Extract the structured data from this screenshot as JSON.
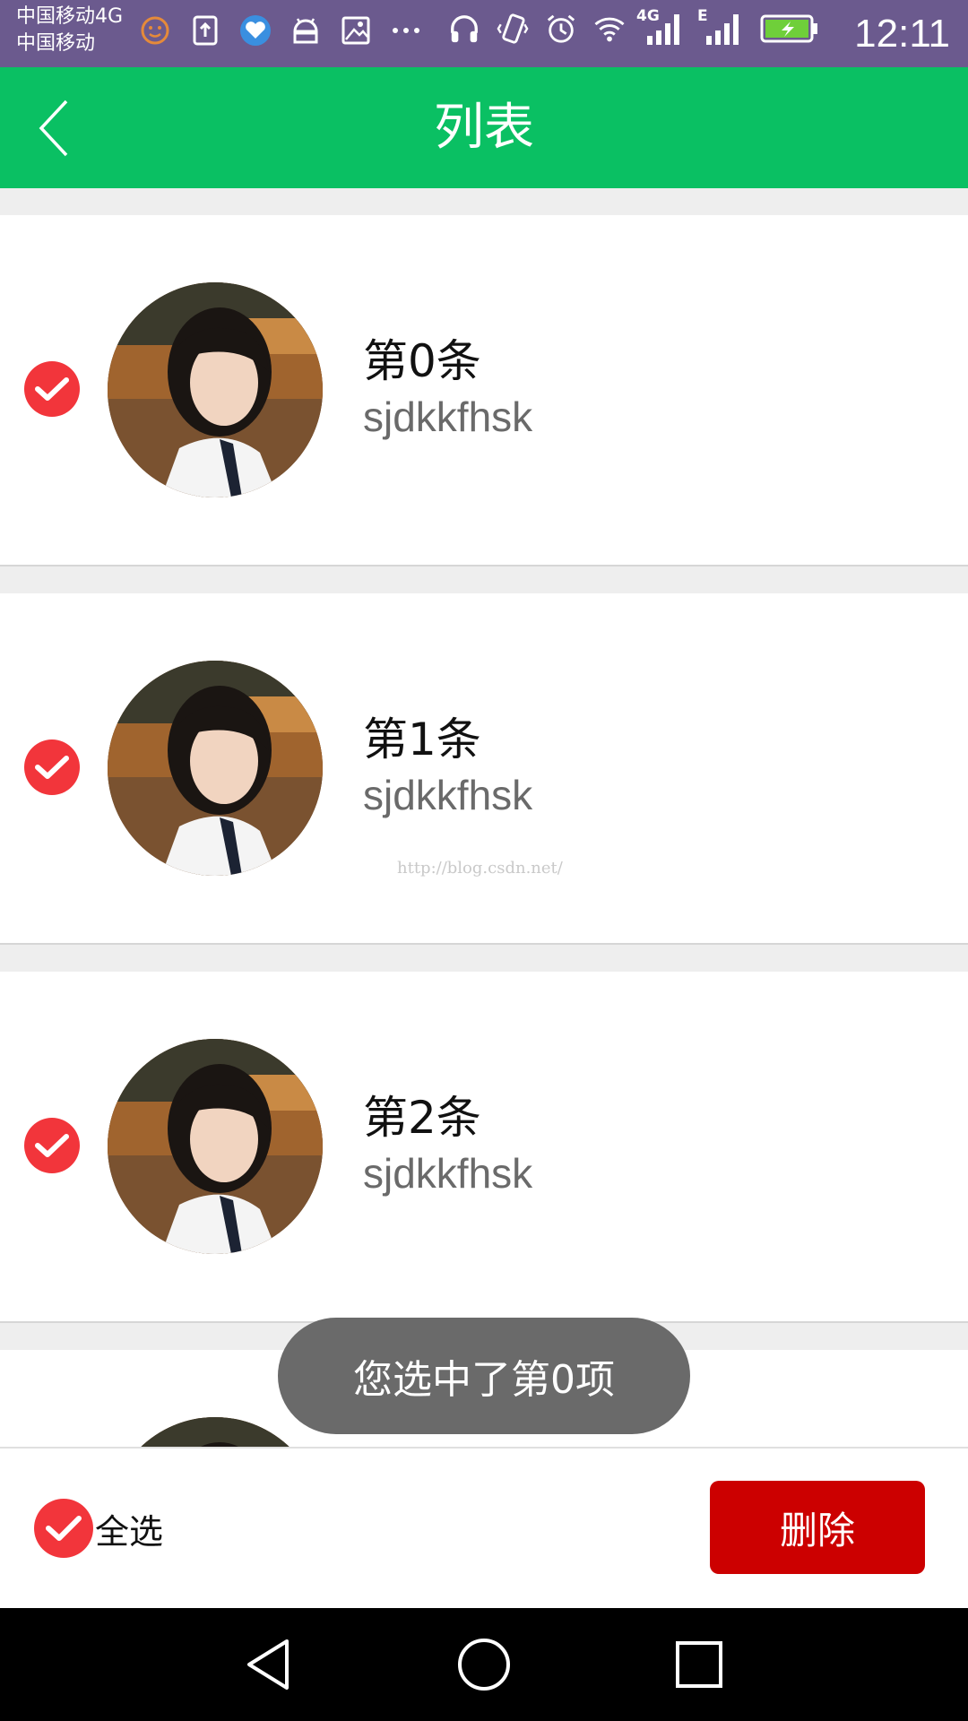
{
  "status_bar": {
    "carrier_line1": "中国移动4G",
    "carrier_line2": "中国移动",
    "time": "12:11",
    "network_4g": "4G",
    "network_e": "E",
    "icons_left": [
      "face-icon",
      "upload-icon",
      "health-icon",
      "android-icon",
      "image-icon",
      "more-icon"
    ],
    "icons_right": [
      "headphones-icon",
      "vibrate-icon",
      "alarm-icon",
      "wifi-icon",
      "signal-4g-icon",
      "signal-e-icon",
      "battery-charging-icon"
    ]
  },
  "header": {
    "title": "列表",
    "back_icon": "chevron-left-icon"
  },
  "list": {
    "items": [
      {
        "title": "第0条",
        "subtitle": "sjdkkfhsk",
        "checked": true
      },
      {
        "title": "第1条",
        "subtitle": "sjdkkfhsk",
        "checked": true
      },
      {
        "title": "第2条",
        "subtitle": "sjdkkfhsk",
        "checked": true
      }
    ]
  },
  "watermark": "http://blog.csdn.net/",
  "toast": "您选中了第0项",
  "footer": {
    "select_all_label": "全选",
    "select_all_checked": true,
    "delete_label": "删除"
  },
  "colors": {
    "header_bg": "#0ac063",
    "status_bg": "#6b5a8e",
    "check_red": "#f2353b",
    "delete_red": "#cc0000",
    "toast_bg": "#6a6a6a"
  }
}
